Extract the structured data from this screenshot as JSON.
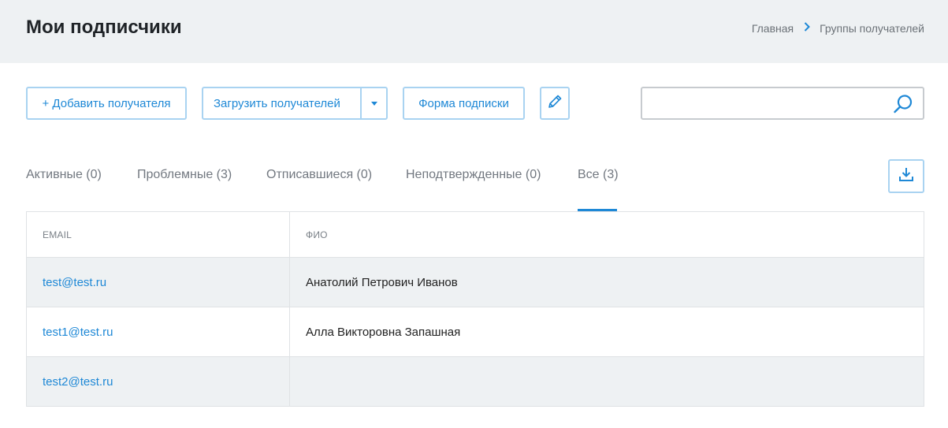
{
  "header": {
    "title": "Мои подписчики",
    "breadcrumb": [
      "Главная",
      "Группы получателей"
    ]
  },
  "toolbar": {
    "add_label": "+ Добавить получателя",
    "upload_label": "Загрузить получателей",
    "form_label": "Форма подписки",
    "search_placeholder": ""
  },
  "tabs": [
    {
      "label": "Активные (0)"
    },
    {
      "label": "Проблемные (3)"
    },
    {
      "label": "Отписавшиеся (0)"
    },
    {
      "label": "Неподтвержденные (0)"
    },
    {
      "label": "Все (3)",
      "active": true
    }
  ],
  "table": {
    "columns": [
      "EMAIL",
      "ФИО"
    ],
    "rows": [
      {
        "email": "test@test.ru",
        "name": "Анатолий Петрович Иванов"
      },
      {
        "email": "test1@test.ru",
        "name": "Алла Викторовна Запашная"
      },
      {
        "email": "test2@test.ru",
        "name": ""
      }
    ]
  },
  "icons": {
    "breadcrumb_separator": "chevron-right-icon",
    "upload_dropdown": "caret-down-icon",
    "edit": "pencil-icon",
    "search": "search-icon",
    "download": "download-icon"
  },
  "colors": {
    "accent": "#1e88d6",
    "header_bg": "#eef1f3",
    "button_border": "#a9d3f1"
  }
}
